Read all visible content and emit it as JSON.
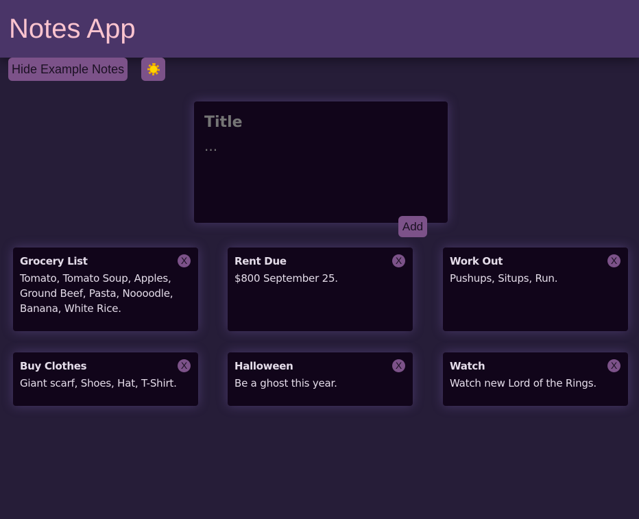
{
  "header": {
    "title": "Notes App"
  },
  "toolbar": {
    "toggle_label": "Hide Example Notes",
    "theme_icon": "sun-icon"
  },
  "composer": {
    "title_placeholder": "Title",
    "body_placeholder": "...",
    "add_label": "Add"
  },
  "notes": [
    {
      "title": "Grocery List",
      "body": "Tomato, Tomato Soup, Apples, Ground Beef, Pasta, Noooodle, Banana, White Rice.",
      "close": "X"
    },
    {
      "title": "Rent Due",
      "body": "$800 September 25.",
      "close": "X"
    },
    {
      "title": "Work Out",
      "body": "Pushups, Situps, Run.",
      "close": "X"
    },
    {
      "title": "Buy Clothes",
      "body": "Giant scarf, Shoes, Hat, T-Shirt.",
      "close": "X"
    },
    {
      "title": "Halloween",
      "body": "Be a ghost this year.",
      "close": "X"
    },
    {
      "title": "Watch",
      "body": "Watch new Lord of the Rings.",
      "close": "X"
    }
  ],
  "colors": {
    "background": "#261d38",
    "header": "#4a3568",
    "accent": "#7c5289",
    "title": "#fbc4cf",
    "card": "#11051a"
  }
}
